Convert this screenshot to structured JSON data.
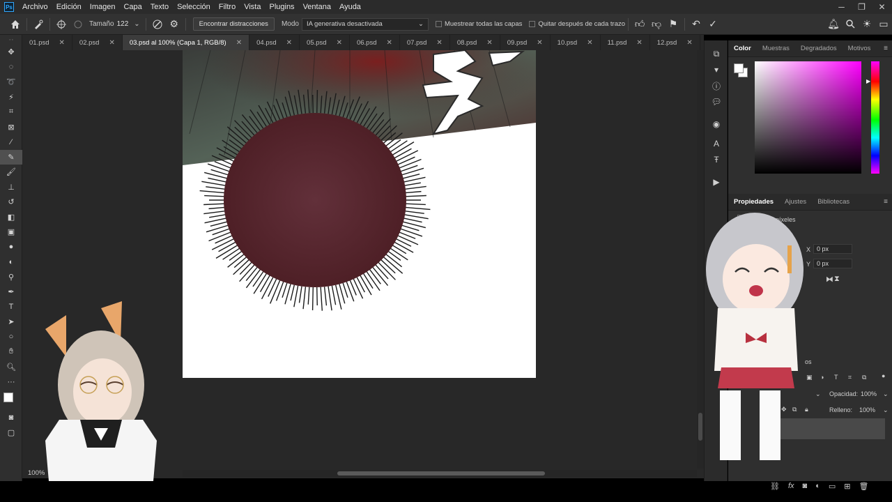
{
  "app": {
    "logo": "Ps"
  },
  "menu": [
    "Archivo",
    "Edición",
    "Imagen",
    "Capa",
    "Texto",
    "Selección",
    "Filtro",
    "Vista",
    "Plugins",
    "Ventana",
    "Ayuda"
  ],
  "options": {
    "size_label": "Tamaño",
    "size_value": "122",
    "distractions_button": "Encontrar distracciones",
    "mode_label": "Modo",
    "mode_value": "IA generativa desactivada",
    "sample_all_layers": "Muestrear todas las capas",
    "remove_after_stroke": "Quitar después de cada trazo"
  },
  "tabs": [
    {
      "label": "01.psd"
    },
    {
      "label": "02.psd"
    },
    {
      "label": "03.psd al 100% (Capa 1, RGB/8)",
      "active": true
    },
    {
      "label": "04.psd"
    },
    {
      "label": "05.psd"
    },
    {
      "label": "06.psd"
    },
    {
      "label": "07.psd"
    },
    {
      "label": "08.psd"
    },
    {
      "label": "09.psd"
    },
    {
      "label": "10.psd"
    },
    {
      "label": "11.psd"
    },
    {
      "label": "12.psd"
    }
  ],
  "zoom": "100%",
  "color_panel": {
    "tabs": [
      "Color",
      "Muestras",
      "Degradados",
      "Motivos"
    ],
    "active": "Color"
  },
  "properties_panel": {
    "tabs": [
      "Propiedades",
      "Ajustes",
      "Bibliotecas"
    ],
    "active": "Propiedades",
    "layer_type": "a de píxeles",
    "x_label": "X",
    "x_value": "0 px",
    "y_label": "Y",
    "y_value": "0 px"
  },
  "layers_panel": {
    "tab_fragment": "os",
    "opacity_label": "Opacidad:",
    "opacity_value": "100%",
    "fill_label": "Relleno:",
    "fill_value": "100%"
  },
  "colors": {
    "accent": "#31a8ff",
    "dark_bg": "#282828",
    "panel_bg": "#2f2f2f",
    "burst_fill": "#5e2a30"
  }
}
